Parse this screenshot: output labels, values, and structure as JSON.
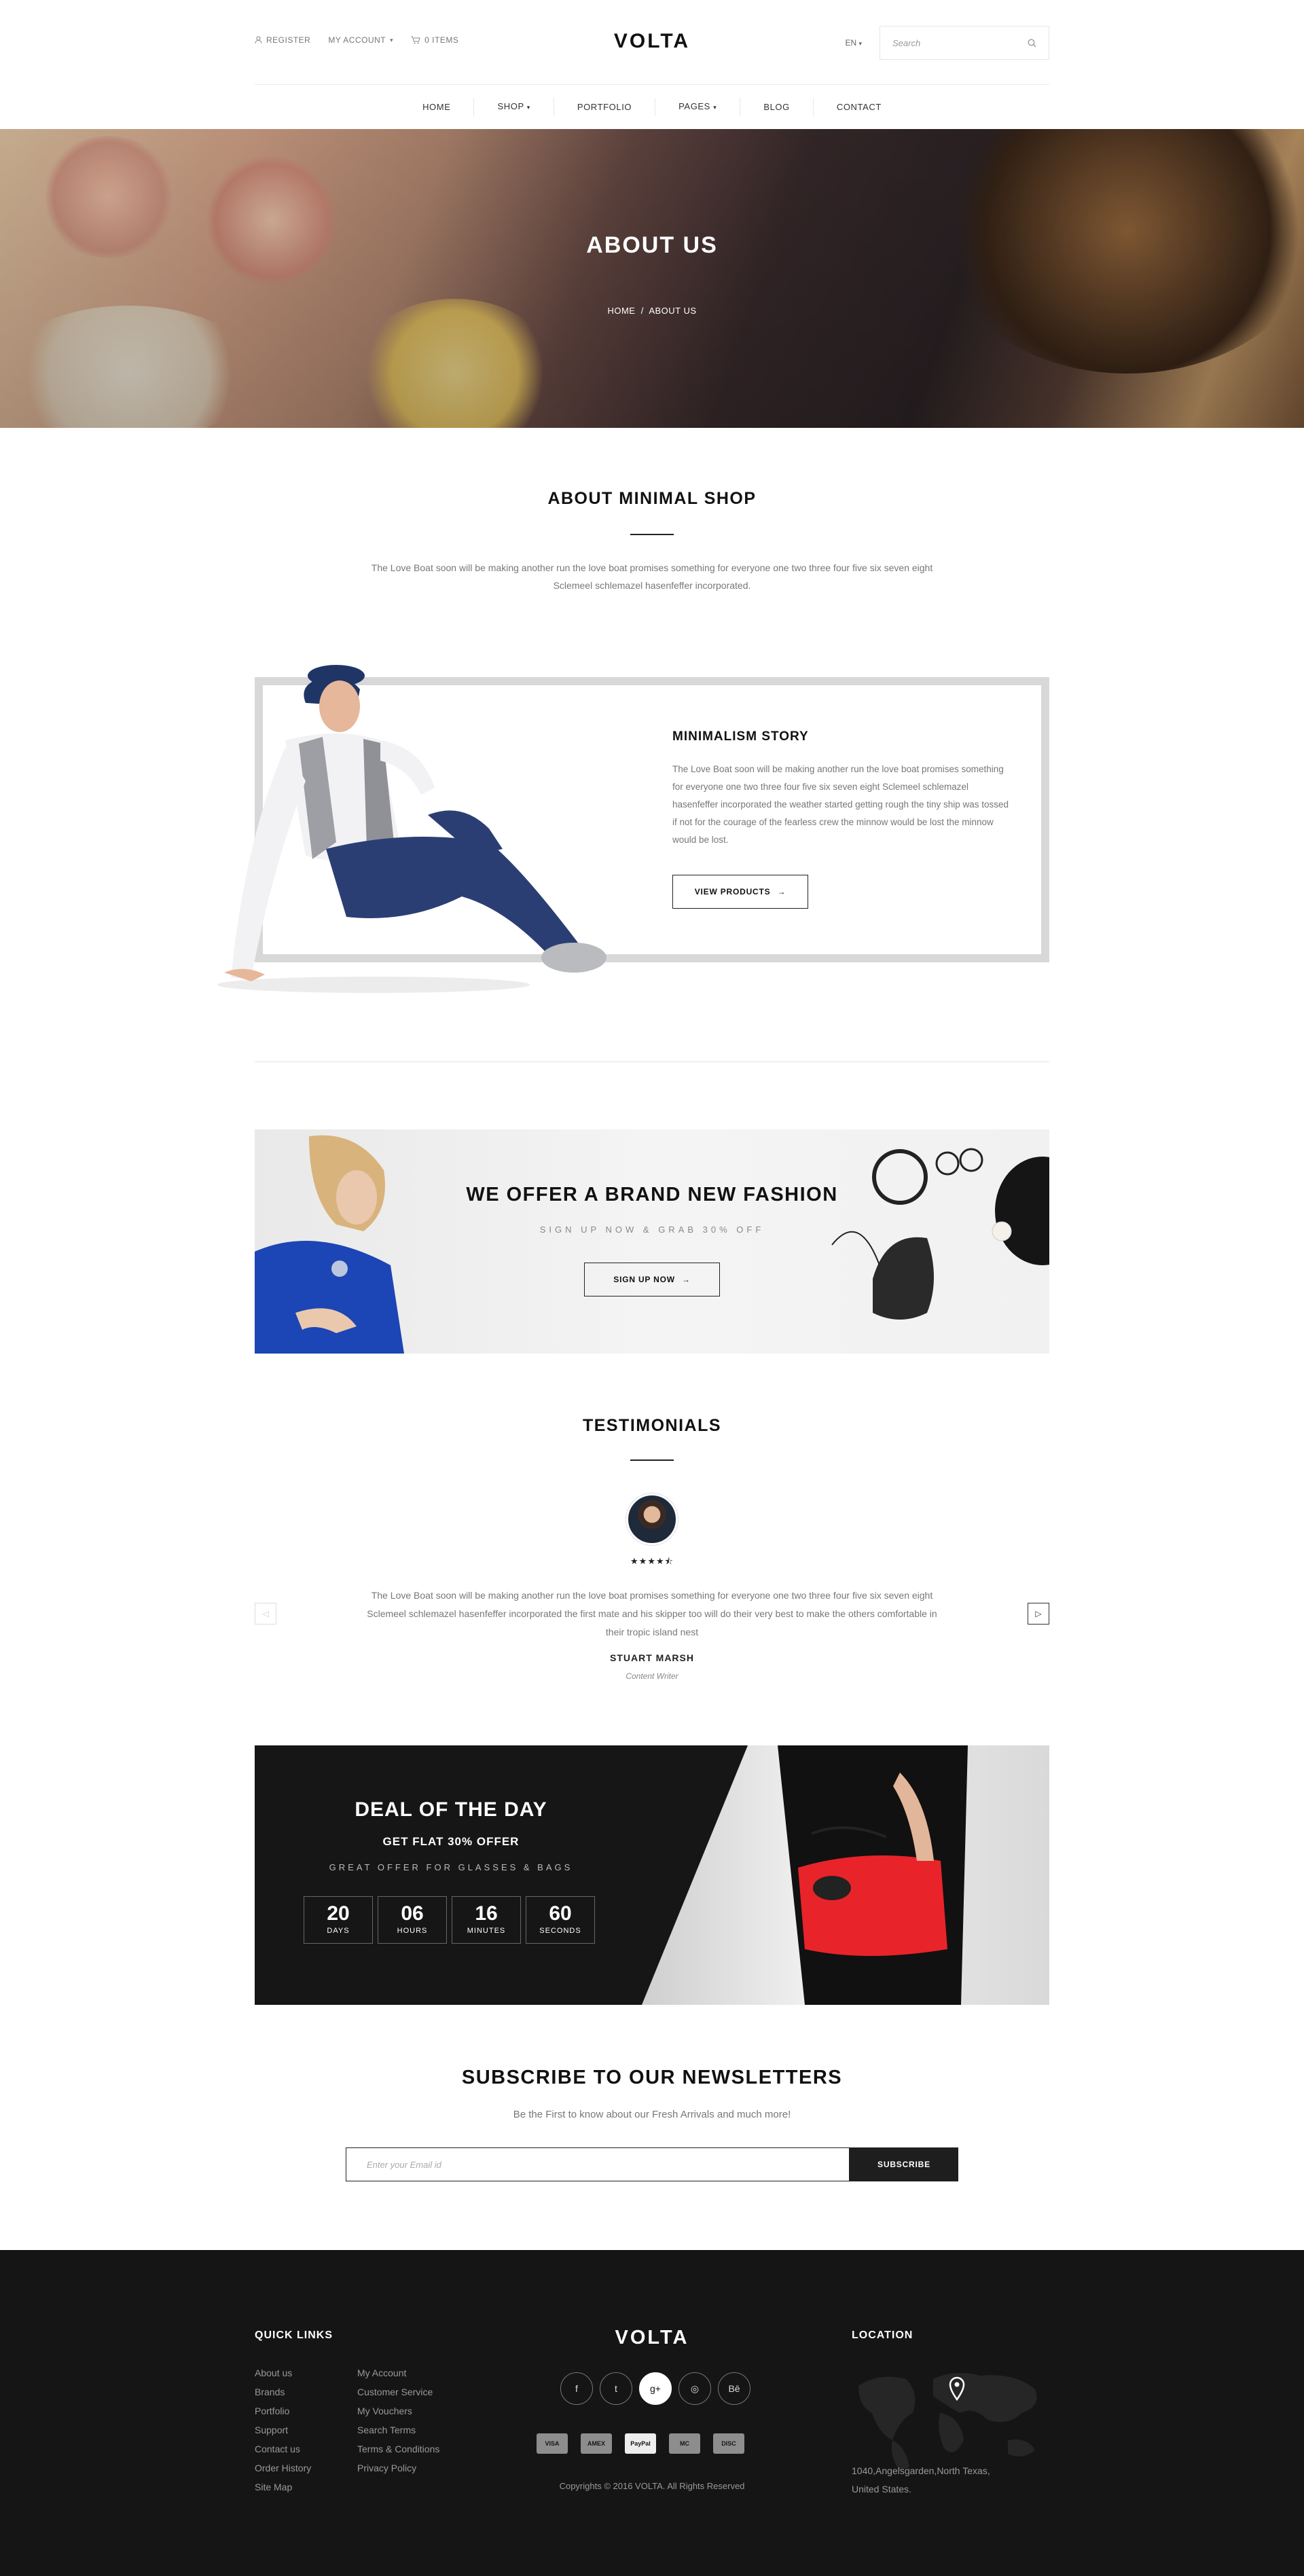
{
  "header": {
    "register": "REGISTER",
    "account": "MY ACCOUNT",
    "cart": "0 ITEMS",
    "logo": "VOLTA",
    "language": "EN",
    "search_placeholder": "Search"
  },
  "nav": [
    "HOME",
    "SHOP",
    "PORTFOLIO",
    "PAGES",
    "BLOG",
    "CONTACT"
  ],
  "hero": {
    "title": "ABOUT US",
    "breadcrumb": [
      "HOME",
      "ABOUT US"
    ]
  },
  "about": {
    "title": "ABOUT MINIMAL SHOP",
    "text": "The Love Boat soon will be making another run the love boat promises something for everyone one two three four five six seven eight Sclemeel schlemazel hasenfeffer incorporated."
  },
  "story": {
    "title": "MINIMALISM STORY",
    "text": "The Love Boat soon will be making another run the love boat promises something for everyone one two three four five six seven eight Sclemeel schlemazel hasenfeffer incorporated the weather started getting rough the tiny ship was tossed if not for the courage of the fearless crew the minnow would be lost the minnow would be lost.",
    "button": "VIEW PRODUCTS"
  },
  "fashion": {
    "title": "WE OFFER A BRAND NEW FASHION",
    "subtitle": "SIGN UP NOW & GRAB 30% OFF",
    "button": "SIGN UP NOW"
  },
  "testimonials": {
    "title": "TESTIMONIALS",
    "rating": 4.5,
    "quote": "The Love Boat soon will be making another run the love boat promises something for everyone one two three four five six seven eight Sclemeel schlemazel hasenfeffer incorporated the first mate and his skipper too will do their very best to make the others comfortable in their tropic island nest",
    "author": "STUART MARSH",
    "role": "Content Writer"
  },
  "deal": {
    "title": "DEAL OF THE DAY",
    "offer": "GET FLAT 30% OFFER",
    "tagline": "GREAT OFFER FOR GLASSES & BAGS",
    "counters": [
      {
        "value": "20",
        "label": "DAYS"
      },
      {
        "value": "06",
        "label": "HOURS"
      },
      {
        "value": "16",
        "label": "MINUTES"
      },
      {
        "value": "60",
        "label": "SECONDS"
      }
    ]
  },
  "subscribe": {
    "title": "SUBSCRIBE TO OUR NEWSLETTERS",
    "subtitle": "Be the First to know about our Fresh Arrivals and much more!",
    "placeholder": "Enter your Email id",
    "button": "SUBSCRIBE"
  },
  "footer": {
    "quick_links_title": "QUICK LINKS",
    "links_col1": [
      "About us",
      "Brands",
      "Portfolio",
      "Support",
      "Contact us",
      "Order History",
      "Site Map"
    ],
    "links_col2": [
      "My Account",
      "Customer Service",
      "My Vouchers",
      "Search Terms",
      "Terms & Conditions",
      "Privacy Policy"
    ],
    "logo": "VOLTA",
    "socials": [
      "f",
      "t",
      "g+",
      "◎",
      "Bē"
    ],
    "payments": [
      "VISA",
      "AMEX",
      "PayPal",
      "MC",
      "DISC"
    ],
    "copyright": "Copyrights © 2016 VOLTA. All Rights Reserved",
    "location_title": "LOCATION",
    "address": "1040,Angelsgarden,North Texas, United States."
  },
  "colors": {
    "accent": "#111111",
    "footer_bg": "#151515",
    "deal_bg": "#161616",
    "text_muted": "#777777"
  }
}
